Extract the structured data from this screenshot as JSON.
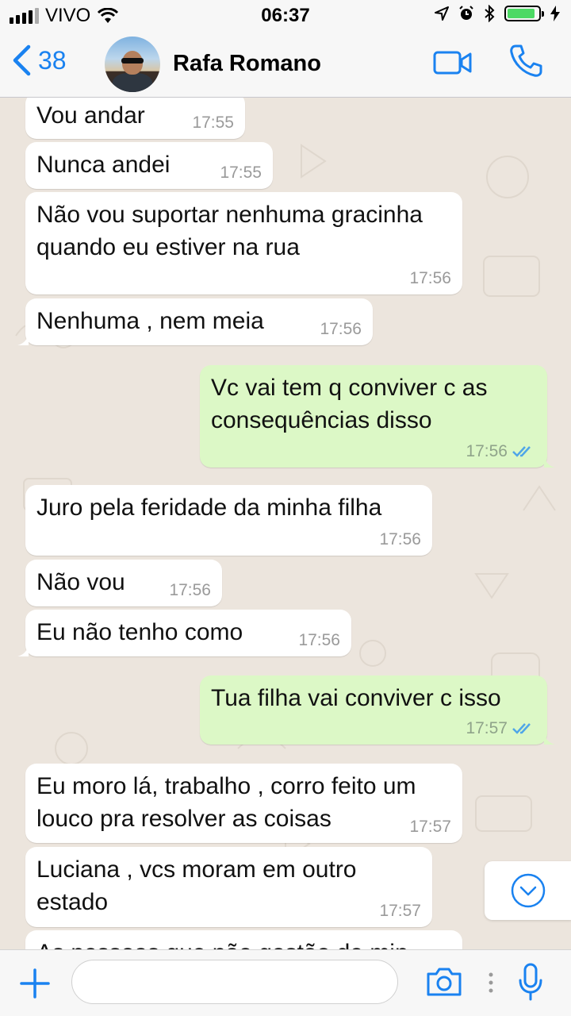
{
  "status": {
    "carrier": "VIVO",
    "time": "06:37",
    "battery_level": 0.9,
    "icons": [
      "signal-icon",
      "wifi-icon",
      "location-icon",
      "alarm-icon",
      "bluetooth-icon",
      "battery-icon",
      "charging-icon"
    ]
  },
  "header": {
    "back_count": "38",
    "contact_name": "Rafa Romano",
    "icons": [
      "chevron-left-icon",
      "video-call-icon",
      "phone-icon"
    ]
  },
  "colors": {
    "accent": "#1a82f0",
    "outgoing_bubble": "#dcf8c6",
    "incoming_bubble": "#ffffff",
    "chat_background": "#ece5dd",
    "read_ticks": "#4fa6e8"
  },
  "messages": [
    {
      "dir": "in",
      "text": "Vou andar",
      "time": "17:55"
    },
    {
      "dir": "in",
      "text": "Nunca andei",
      "time": "17:55"
    },
    {
      "dir": "in",
      "text": "Não vou suportar nenhuma gracinha quando eu estiver na rua",
      "time": "17:56"
    },
    {
      "dir": "in",
      "text": "Nenhuma , nem meia",
      "time": "17:56"
    },
    {
      "dir": "out",
      "text": "Vc vai tem q conviver c as consequências disso",
      "time": "17:56",
      "read": true
    },
    {
      "dir": "in",
      "text": "Juro pela feridade da minha filha",
      "time": "17:56"
    },
    {
      "dir": "in",
      "text": "Não vou",
      "time": "17:56"
    },
    {
      "dir": "in",
      "text": "Eu não tenho como",
      "time": "17:56"
    },
    {
      "dir": "out",
      "text": "Tua filha vai conviver c isso",
      "time": "17:57",
      "read": true
    },
    {
      "dir": "in",
      "text": "Eu moro lá, trabalho , corro feito um louco pra resolver as coisas",
      "time": "17:57"
    },
    {
      "dir": "in",
      "text": "Luciana , vcs moram em outro estado",
      "time": "17:57"
    },
    {
      "dir": "in",
      "text": "As pessoas que não gostão de min",
      "time": ""
    }
  ],
  "composer": {
    "placeholder": "",
    "icons": [
      "plus-icon",
      "camera-icon",
      "more-dots-icon",
      "microphone-icon",
      "scroll-down-icon"
    ]
  }
}
